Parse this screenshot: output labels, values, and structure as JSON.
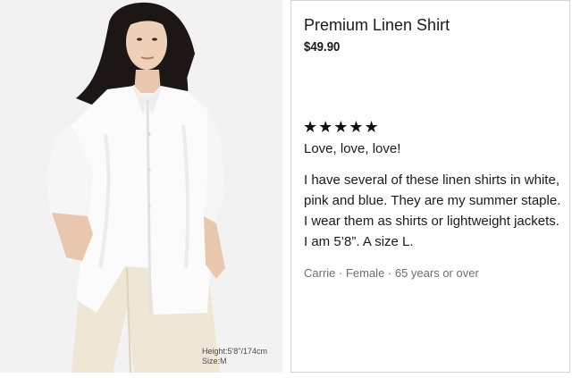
{
  "product": {
    "name": "Premium Linen Shirt",
    "price": "$49.90"
  },
  "photo": {
    "caption_height": "Height:5'8\"/174cm",
    "caption_size": "Size:M"
  },
  "review": {
    "rating": 5,
    "rating_stars": "★★★★★",
    "title": "Love, love, love!",
    "body": "I have several of these linen shirts in white, pink and blue. They are my summer staple. I wear them as shirts or lightweight jackets. I am 5’8”. A size L.",
    "reviewer_meta": "Carrie · Female · 65 years or over"
  },
  "colors": {
    "background": "#ffffff",
    "photo_background": "#f2f2f2",
    "card_border": "#d4d4d4",
    "meta_text": "#6e6e6e"
  }
}
